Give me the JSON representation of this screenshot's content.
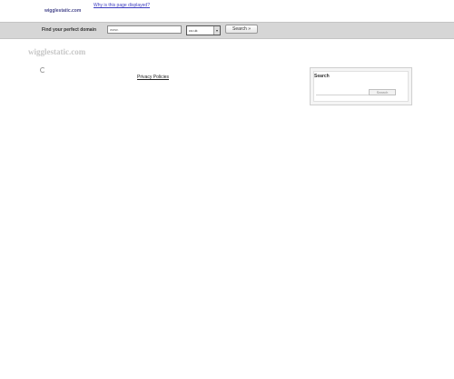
{
  "header": {
    "domain": "wigglestatic.com",
    "parked_link": "Why is this page displayed?"
  },
  "search_bar": {
    "label": "Find your perfect domain",
    "input_value": "www.",
    "tld_selected": "co.uk",
    "button_label": "Search »"
  },
  "main": {
    "site_title": "wigglestatic.com",
    "privacy_link": "Privacy Policies"
  },
  "sidebar": {
    "title": "Search",
    "button_label": "Search"
  }
}
